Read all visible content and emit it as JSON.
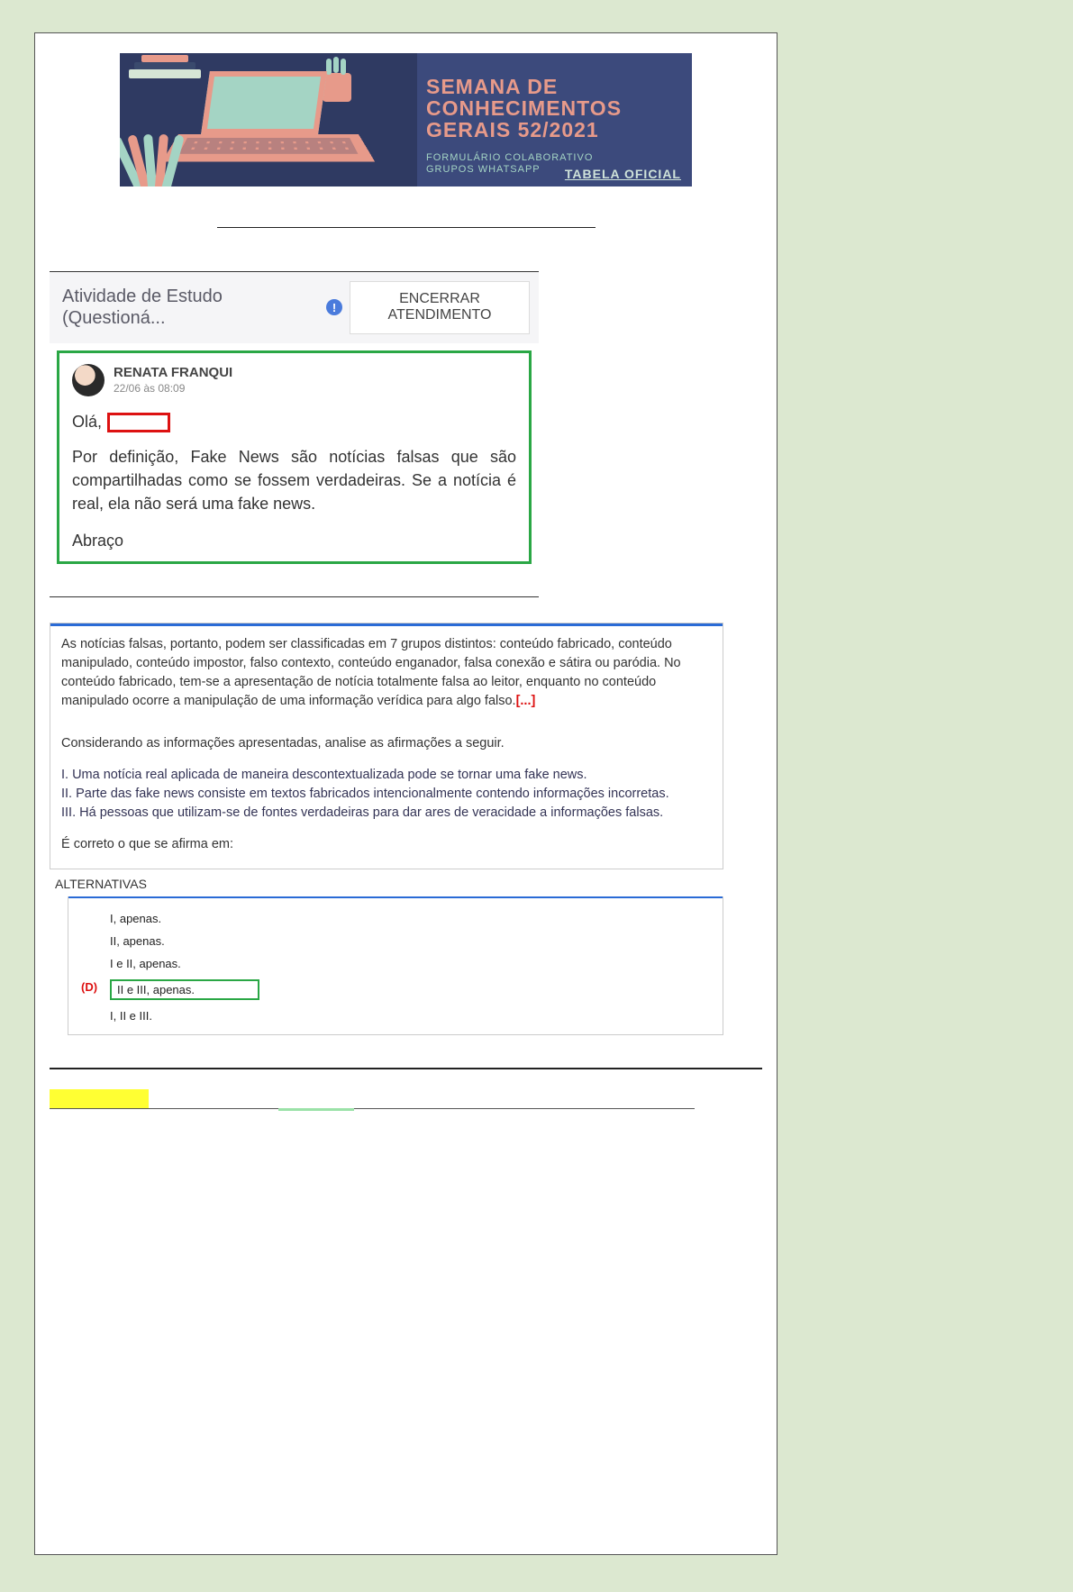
{
  "banner": {
    "title_line1": "SEMANA DE",
    "title_line2": "CONHECIMENTOS",
    "title_line3": "GERAIS 52/2021",
    "sub_line1": "FORMULÁRIO COLABORATIVO",
    "sub_line2": "GRUPOS WHATSAPP",
    "link_label": "TABELA OFICIAL"
  },
  "chat": {
    "header_title": "Atividade de Estudo (Questioná...",
    "info_badge": "!",
    "end_button": "ENCERRAR ATENDIMENTO",
    "author_name": "RENATA FRANQUI",
    "author_date": "22/06 às 08:09",
    "greeting": "Olá,",
    "body": "Por definição, Fake News são notícias falsas que são compartilhadas como se fossem verdadeiras. Se a notícia é real, ela não será uma fake news.",
    "signoff": "Abraço"
  },
  "question": {
    "context": "As notícias falsas, portanto, podem ser classificadas em 7 grupos distintos: conteúdo fabricado, conteúdo manipulado, conteúdo impostor, falso contexto, conteúdo enganador, falsa conexão e sátira ou paródia. No conteúdo fabricado, tem-se a apresentação de notícia totalmente falsa ao leitor, enquanto no conteúdo manipulado ocorre a manipulação de uma informação verídica para algo falso.",
    "ellipsis": "[...]",
    "lead": "Considerando as informações apresentadas, analise as afirmações a seguir.",
    "statements": {
      "i": "I. Uma notícia real aplicada de maneira descontextualizada pode se tornar uma fake news.",
      "ii": "II. Parte das fake news consiste em textos fabricados intencionalmente contendo informações incorretas.",
      "iii": "III. Há pessoas que utilizam-se de fontes verdadeiras para dar ares de veracidade a informações falsas."
    },
    "prompt": "É correto o que se afirma em:",
    "alternatives_header": "ALTERNATIVAS",
    "alternatives": {
      "a": "I, apenas.",
      "b": "II, apenas.",
      "c": "I e II, apenas.",
      "d": "II e III, apenas.",
      "e": "I, II e III."
    },
    "highlighted_letter": "(D)"
  }
}
